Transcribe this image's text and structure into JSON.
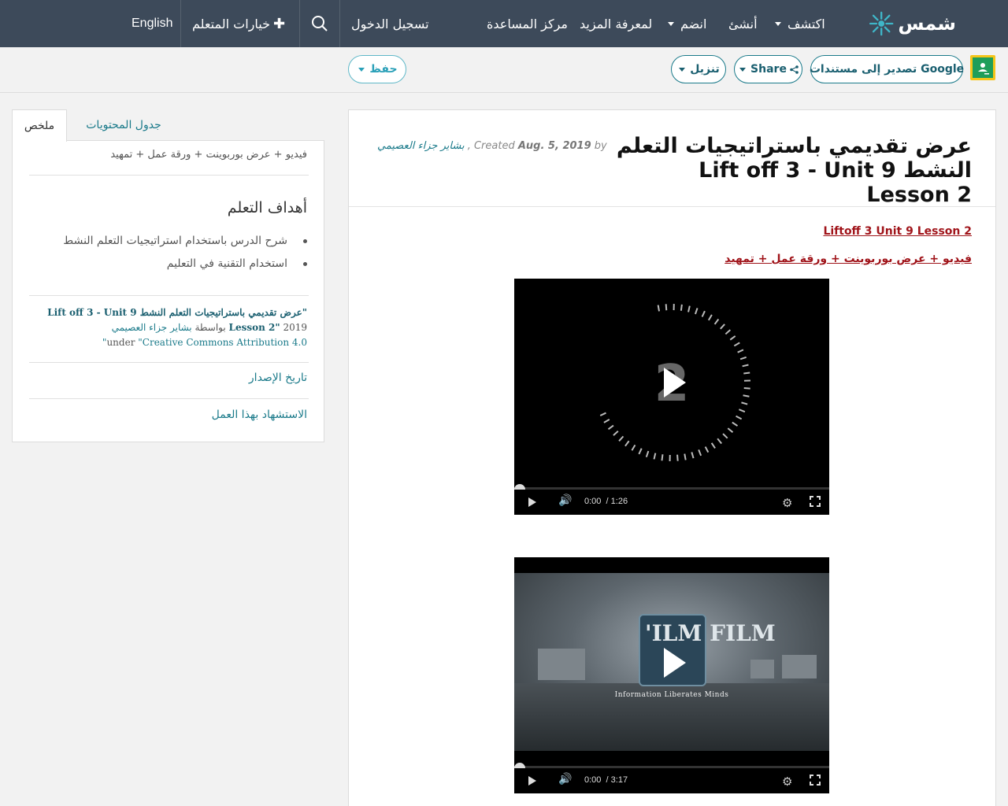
{
  "nav": {
    "logo_text": "شمس",
    "explore": "اكتشف",
    "create": "أنشئ",
    "join": "انضم",
    "learn_more": "لمعرفة المزيد",
    "help_center": "مركز المساعدة",
    "login": "تسجيل الدخول",
    "learner_options": "خيارات المتعلم",
    "language": "English"
  },
  "toolbar": {
    "export_google": "تصدير إلى مستندات Google",
    "share": "Share",
    "download": "تنزيل",
    "save": "حفظ"
  },
  "resource": {
    "title": "عرض تقديمي باستراتيجيات التعلم النشط Lift off 3 - Unit 9 Lesson 2",
    "by_label": "by",
    "date": "Aug. 5, 2019",
    "created_label": "Created",
    "author": "بشاير جزاء العصيمي",
    "link1": "Liftoff 3 Unit 9 Lesson 2",
    "link2": "فيديو + عرض بوربوينت + ورقة عمل + تمهيد"
  },
  "videos": [
    {
      "time_current": "0:00",
      "time_total": "1:26",
      "progress": 0
    },
    {
      "time_current": "0:00",
      "time_total": "3:17",
      "progress": 0,
      "logo_text": "'ILM FILM",
      "caption": "Information Liberates Minds"
    }
  ],
  "sidebar": {
    "tab_summary": "ملخص",
    "tab_contents": "جدول المحتويات",
    "summary_text": "فيديو + عرض بوربوينت + ورقة عمل + تمهيد",
    "objectives_heading": "أهداف التعلم",
    "objectives": [
      "شرح الدرس باستخدام استراتيجيات التعلم النشط",
      "استخدام التقنية في التعليم"
    ],
    "citation_title": "\"عرض تقديمي باستراتيجيات التعلم النشط Lift off 3 - Unit 9 Lesson 2\"",
    "citation_year": "2019",
    "citation_by": "بواسطة",
    "citation_author": "بشاير جزاء العصيمي",
    "citation_under": "under",
    "citation_license": "\"Creative Commons Attribution 4.0\"",
    "version_history": "تاريخ الإصدار",
    "cite_work": "الاستشهاد بهذا العمل"
  }
}
